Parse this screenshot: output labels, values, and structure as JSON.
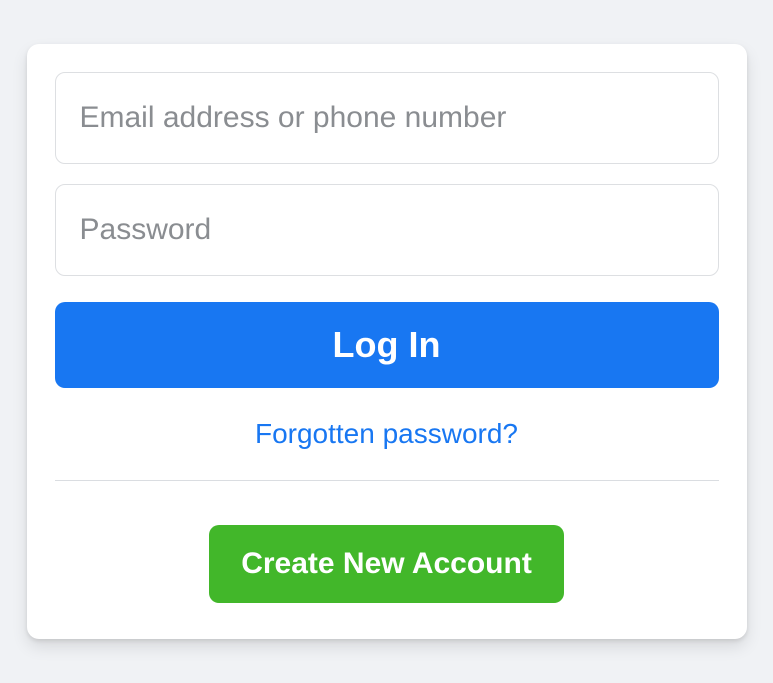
{
  "login": {
    "email_placeholder": "Email address or phone number",
    "password_placeholder": "Password",
    "login_label": "Log In",
    "forgot_label": "Forgotten password?",
    "create_label": "Create New Account"
  }
}
